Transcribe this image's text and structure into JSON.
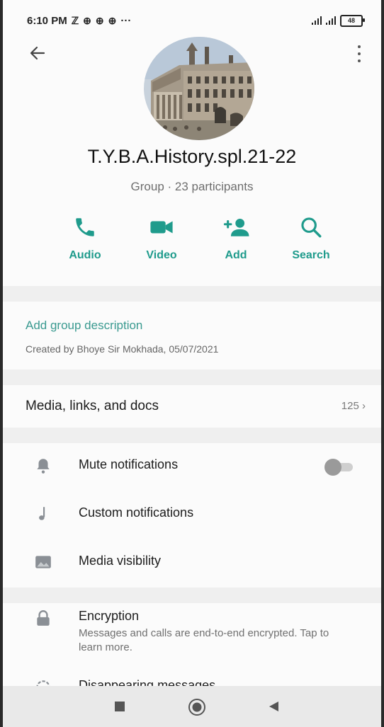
{
  "status_bar": {
    "time": "6:10 PM",
    "more": "···",
    "battery": "48"
  },
  "group": {
    "name": "T.Y.B.A.History.spl.21-22",
    "subtitle": "Group · 23 participants"
  },
  "actions": [
    {
      "label": "Audio",
      "icon": "phone-icon"
    },
    {
      "label": "Video",
      "icon": "video-camera-icon"
    },
    {
      "label": "Add",
      "icon": "add-person-icon"
    },
    {
      "label": "Search",
      "icon": "search-icon"
    }
  ],
  "description": {
    "link": "Add group description",
    "created": "Created by Bhoye Sir Mokhada, 05/07/2021"
  },
  "media": {
    "label": "Media, links, and docs",
    "count": "125"
  },
  "settings": [
    {
      "label": "Mute notifications",
      "icon": "bell-icon",
      "toggle": false
    },
    {
      "label": "Custom notifications",
      "icon": "music-note-icon"
    },
    {
      "label": "Media visibility",
      "icon": "image-icon"
    }
  ],
  "encryption": {
    "label": "Encryption",
    "description": "Messages and calls are end-to-end encrypted. Tap to learn more."
  },
  "disappearing": {
    "label": "Disappearing messages"
  },
  "colors": {
    "accent": "#1f9b8c",
    "icon_gray": "#8a8f95"
  }
}
